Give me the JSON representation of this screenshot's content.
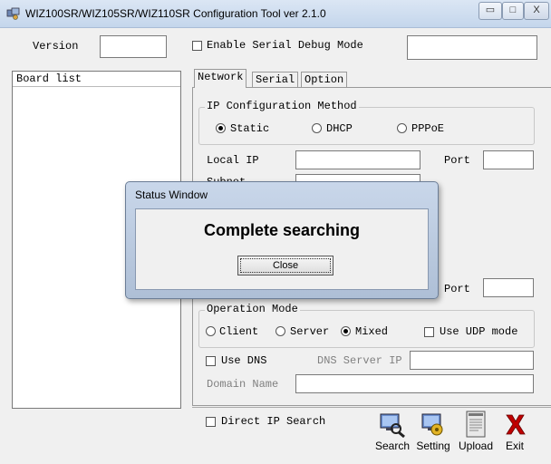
{
  "window": {
    "title": "WIZ100SR/WIZ105SR/WIZ110SR Configuration Tool ver 2.1.0",
    "minimize_glyph": "▭",
    "maximize_glyph": "□",
    "close_glyph": "X"
  },
  "top": {
    "version_label": "Version",
    "version_value": "",
    "debug_label": "Enable Serial Debug Mode",
    "debug_checked": false,
    "debug_field_value": ""
  },
  "board_list": {
    "header": "Board list",
    "items": []
  },
  "tabs": [
    {
      "label": "Network",
      "active": true
    },
    {
      "label": "Serial",
      "active": false
    },
    {
      "label": "Option",
      "active": false
    }
  ],
  "network": {
    "ip_method": {
      "title": "IP Configuration Method",
      "options": [
        "Static",
        "DHCP",
        "PPPoE"
      ],
      "selected": "Static"
    },
    "local_ip_label": "Local IP",
    "port_label": "Port",
    "subnet_label_partial": "Subnet",
    "port2_label": "Port",
    "operation_mode": {
      "title": "Operation Mode",
      "options": [
        "Client",
        "Server",
        "Mixed"
      ],
      "selected": "Mixed",
      "udp_label": "Use UDP mode"
    },
    "use_dns_label": "Use DNS",
    "dns_server_label": "DNS Server IP",
    "domain_label": "Domain Name"
  },
  "bottom": {
    "direct_ip_label": "Direct IP Search",
    "buttons": [
      "Search",
      "Setting",
      "Upload",
      "Exit"
    ]
  },
  "status_window": {
    "title": "Status Window",
    "message": "Complete searching",
    "close_label": "Close"
  },
  "colors": {
    "accent_exit": "#c00000",
    "titlebar": "#c4d6ec"
  }
}
